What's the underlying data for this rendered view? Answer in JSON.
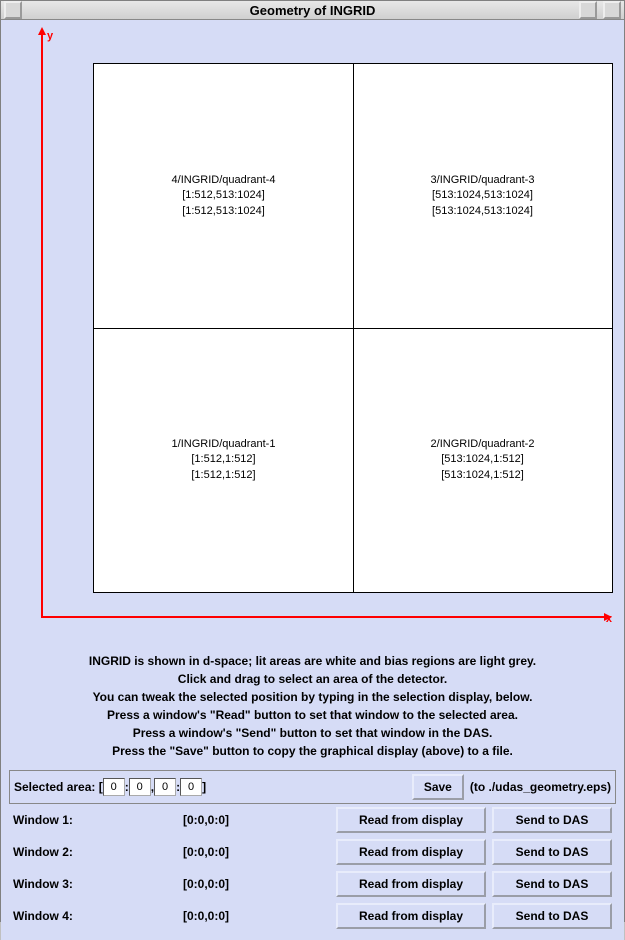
{
  "title": "Geometry of INGRID",
  "axis": {
    "x": "x",
    "y": "y"
  },
  "quadrants": {
    "tl": {
      "name": "4/INGRID/quadrant-4",
      "r1": "[1:512,513:1024]",
      "r2": "[1:512,513:1024]"
    },
    "tr": {
      "name": "3/INGRID/quadrant-3",
      "r1": "[513:1024,513:1024]",
      "r2": "[513:1024,513:1024]"
    },
    "bl": {
      "name": "1/INGRID/quadrant-1",
      "r1": "[1:512,1:512]",
      "r2": "[1:512,1:512]"
    },
    "br": {
      "name": "2/INGRID/quadrant-2",
      "r1": "[513:1024,1:512]",
      "r2": "[513:1024,1:512]"
    }
  },
  "instructions": {
    "l1": "INGRID is shown in d-space; lit areas are white and bias regions are light grey.",
    "l2": "Click and drag to select an area of the detector.",
    "l3": "You can tweak the selected position by typing in the selection display, below.",
    "l4": "Press a window's \"Read\" button to set that window to the selected area.",
    "l5": "Press a window's \"Send\" button to set that window in the DAS.",
    "l6": "Press the \"Save\" button to copy the graphical display (above) to a file."
  },
  "selected": {
    "label": "Selected area: [ ",
    "v1": "0",
    "v2": "0",
    "v3": "0",
    "v4": "0",
    "sep1": " : ",
    "sep2": " , ",
    "sep3": " : ",
    "end": " ]",
    "save": "Save",
    "hint": "(to ./udas_geometry.eps)"
  },
  "windows": [
    {
      "label": "Window 1:",
      "range": "[0:0,0:0]",
      "read": "Read from display",
      "send": "Send to DAS"
    },
    {
      "label": "Window 2:",
      "range": "[0:0,0:0]",
      "read": "Read from display",
      "send": "Send to DAS"
    },
    {
      "label": "Window 3:",
      "range": "[0:0,0:0]",
      "read": "Read from display",
      "send": "Send to DAS"
    },
    {
      "label": "Window 4:",
      "range": "[0:0,0:0]",
      "read": "Read from display",
      "send": "Send to DAS"
    }
  ]
}
